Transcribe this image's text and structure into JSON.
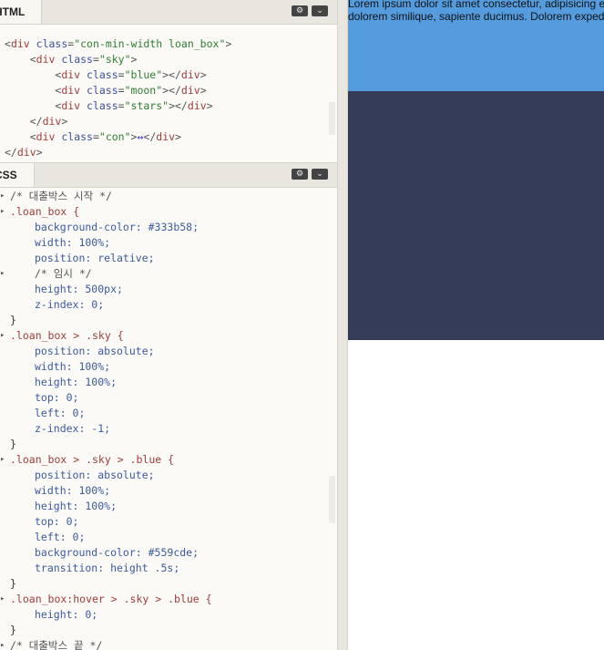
{
  "html_panel": {
    "tab_label": "HTML",
    "lines": [
      [
        "<div ",
        "class",
        "=",
        "\"con-min-width loan_box\"",
        ">"
      ],
      [
        "    <div ",
        "class",
        "=",
        "\"sky\"",
        ">"
      ],
      [
        "        <div ",
        "class",
        "=",
        "\"blue\"",
        "></div>"
      ],
      [
        "        <div ",
        "class",
        "=",
        "\"moon\"",
        "></div>"
      ],
      [
        "        <div ",
        "class",
        "=",
        "\"stars\"",
        "></div>"
      ],
      [
        "    </div>"
      ],
      [
        "    <div ",
        "class",
        "=",
        "\"con\"",
        ">",
        "↔",
        "</div>"
      ],
      [
        "</div>"
      ]
    ]
  },
  "css_panel": {
    "tab_label": "CSS",
    "comment_start": "/* 대출박스 시작 */",
    "rule1_selector": ".loan_box {",
    "rule1": [
      "background-color: #333b58;",
      "width: 100%;",
      "position: relative;",
      "/* 임시 */",
      "height: 500px;",
      "z-index: 0;"
    ],
    "rule2_selector": ".loan_box > .sky {",
    "rule2": [
      "position: absolute;",
      "width: 100%;",
      "height: 100%;",
      "top: 0;",
      "left: 0;",
      "z-index: -1;"
    ],
    "rule3_selector": ".loan_box > .sky > .blue {",
    "rule3": [
      "position: absolute;",
      "width: 100%;",
      "height: 100%;",
      "top: 0;",
      "left: 0;",
      "background-color: #559cde;",
      "transition: height .5s;"
    ],
    "rule4_selector": ".loan_box:hover > .sky > .blue {",
    "rule4": [
      "height: 0;"
    ],
    "close_brace": "}",
    "comment_end": "/* 대출박스 끝 */"
  },
  "preview": {
    "text_line1": "Lorem ipsum dolor sit amet consectetur, adipisicing el",
    "text_line2": "dolorem similique, sapiente ducimus. Dolorem exped",
    "loan_box_color": "#333b58",
    "sky_color": "#559cde"
  },
  "icons": {
    "settings": "gear-icon",
    "collapse": "chevron-down-icon"
  }
}
